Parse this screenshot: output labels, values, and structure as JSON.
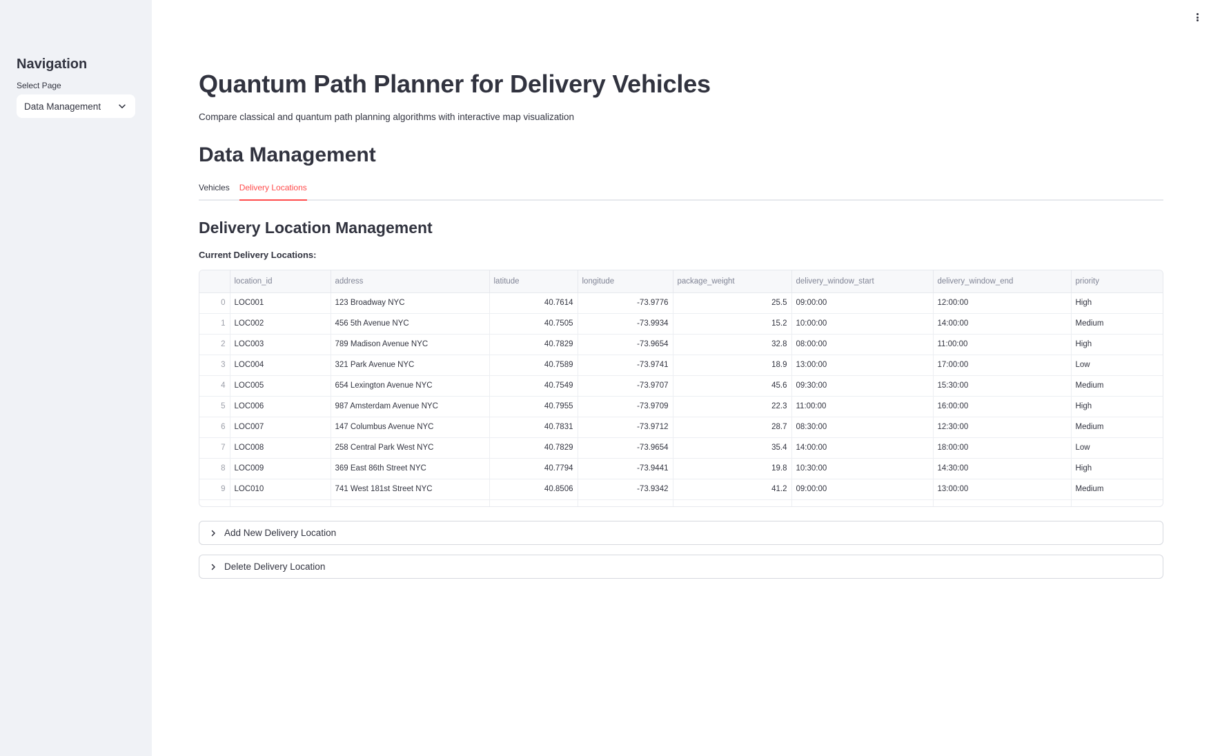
{
  "sidebar": {
    "title": "Navigation",
    "select_label": "Select Page",
    "select_value": "Data Management"
  },
  "header": {
    "title": "Quantum Path Planner for Delivery Vehicles",
    "subtitle": "Compare classical and quantum path planning algorithms with interactive map visualization"
  },
  "section": {
    "title": "Data Management",
    "tabs": [
      {
        "label": "Vehicles",
        "active": false
      },
      {
        "label": "Delivery Locations",
        "active": true
      }
    ]
  },
  "delivery": {
    "heading": "Delivery Location Management",
    "current_label": "Current Delivery Locations:",
    "columns": [
      "",
      "location_id",
      "address",
      "latitude",
      "longitude",
      "package_weight",
      "delivery_window_start",
      "delivery_window_end",
      "priority"
    ],
    "rows": [
      [
        "0",
        "LOC001",
        "123 Broadway NYC",
        "40.7614",
        "-73.9776",
        "25.5",
        "09:00:00",
        "12:00:00",
        "High"
      ],
      [
        "1",
        "LOC002",
        "456 5th Avenue NYC",
        "40.7505",
        "-73.9934",
        "15.2",
        "10:00:00",
        "14:00:00",
        "Medium"
      ],
      [
        "2",
        "LOC003",
        "789 Madison Avenue NYC",
        "40.7829",
        "-73.9654",
        "32.8",
        "08:00:00",
        "11:00:00",
        "High"
      ],
      [
        "3",
        "LOC004",
        "321 Park Avenue NYC",
        "40.7589",
        "-73.9741",
        "18.9",
        "13:00:00",
        "17:00:00",
        "Low"
      ],
      [
        "4",
        "LOC005",
        "654 Lexington Avenue NYC",
        "40.7549",
        "-73.9707",
        "45.6",
        "09:30:00",
        "15:30:00",
        "Medium"
      ],
      [
        "5",
        "LOC006",
        "987 Amsterdam Avenue NYC",
        "40.7955",
        "-73.9709",
        "22.3",
        "11:00:00",
        "16:00:00",
        "High"
      ],
      [
        "6",
        "LOC007",
        "147 Columbus Avenue NYC",
        "40.7831",
        "-73.9712",
        "28.7",
        "08:30:00",
        "12:30:00",
        "Medium"
      ],
      [
        "7",
        "LOC008",
        "258 Central Park West NYC",
        "40.7829",
        "-73.9654",
        "35.4",
        "14:00:00",
        "18:00:00",
        "Low"
      ],
      [
        "8",
        "LOC009",
        "369 East 86th Street NYC",
        "40.7794",
        "-73.9441",
        "19.8",
        "10:30:00",
        "14:30:00",
        "High"
      ],
      [
        "9",
        "LOC010",
        "741 West 181st Street NYC",
        "40.8506",
        "-73.9342",
        "41.2",
        "09:00:00",
        "13:00:00",
        "Medium"
      ]
    ],
    "expanders": [
      {
        "label": "Add New Delivery Location"
      },
      {
        "label": "Delete Delivery Location"
      }
    ]
  },
  "icons": {
    "dropdown": "chevron-down-icon",
    "expander": "chevron-right-icon",
    "menu": "more-vertical-icon"
  },
  "colors": {
    "accent": "#ff4b4b",
    "sidebar_bg": "#f0f2f6",
    "text": "#31333f"
  }
}
